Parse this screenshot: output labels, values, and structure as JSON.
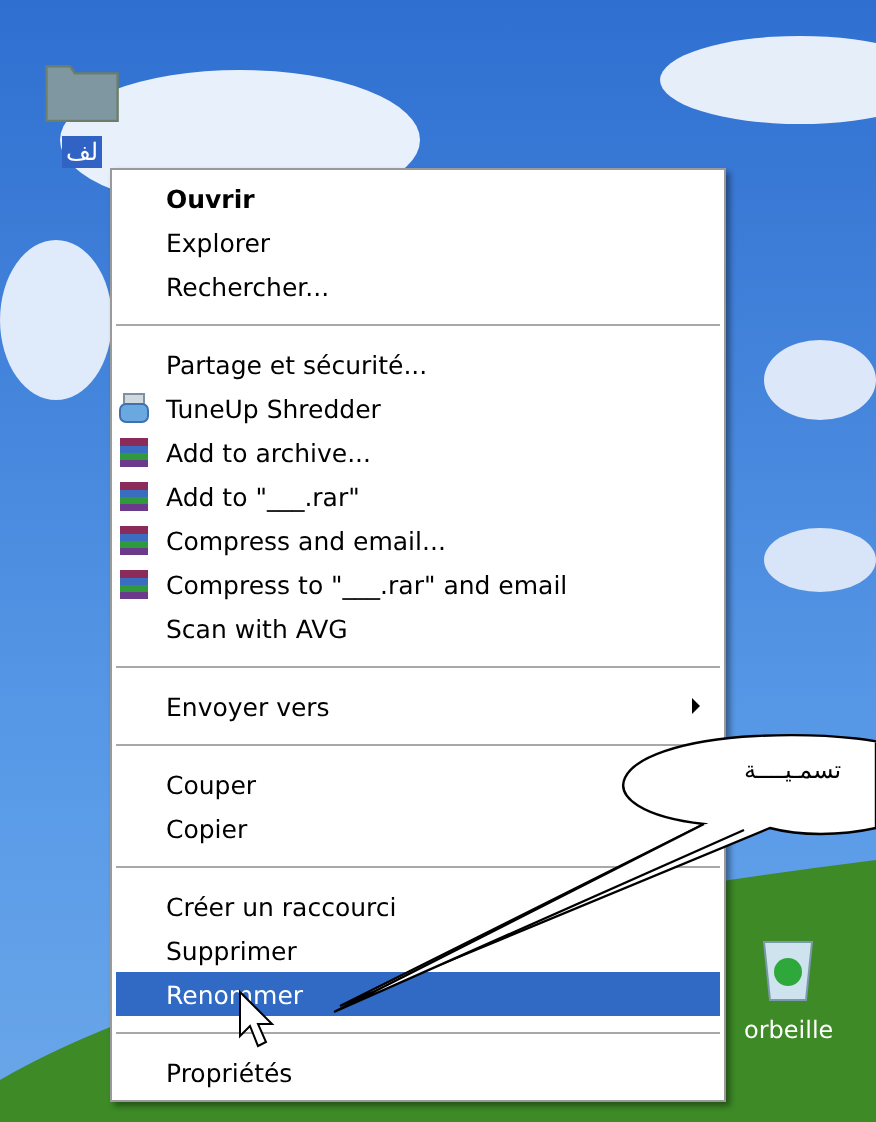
{
  "desktop_icons": [
    {
      "kind": "folder",
      "label": "لف",
      "selected": true
    },
    {
      "kind": "recycle_bin",
      "label": "orbeille",
      "selected": false
    }
  ],
  "context_menu": {
    "items": [
      {
        "kind": "default",
        "label": "Ouvrir",
        "selected": false
      },
      {
        "kind": "item",
        "label": "Explorer",
        "selected": false
      },
      {
        "kind": "item",
        "label": "Rechercher...",
        "selected": false
      },
      {
        "kind": "separator"
      },
      {
        "kind": "item",
        "label": "Partage et sécurité...",
        "selected": false
      },
      {
        "kind": "shredder",
        "label": "TuneUp Shredder",
        "selected": false
      },
      {
        "kind": "archive",
        "label": "Add to archive...",
        "selected": false
      },
      {
        "kind": "archive",
        "label": "Add to \"___.rar\"",
        "selected": false
      },
      {
        "kind": "archive",
        "label": "Compress and email...",
        "selected": false
      },
      {
        "kind": "archive",
        "label": "Compress to \"___.rar\" and email",
        "selected": false
      },
      {
        "kind": "item",
        "label": "Scan with AVG",
        "selected": false
      },
      {
        "kind": "separator"
      },
      {
        "kind": "submenu",
        "label": "Envoyer vers",
        "selected": false
      },
      {
        "kind": "separator"
      },
      {
        "kind": "item",
        "label": "Couper",
        "selected": false
      },
      {
        "kind": "item",
        "label": "Copier",
        "selected": false
      },
      {
        "kind": "separator"
      },
      {
        "kind": "item",
        "label": "Créer un raccourci",
        "selected": false
      },
      {
        "kind": "item",
        "label": "Supprimer",
        "selected": false
      },
      {
        "kind": "item",
        "label": "Renommer",
        "selected": true
      },
      {
        "kind": "separator"
      },
      {
        "kind": "item",
        "label": "Propriétés",
        "selected": false
      }
    ]
  },
  "callout": {
    "text": "تسمـيــــة"
  }
}
